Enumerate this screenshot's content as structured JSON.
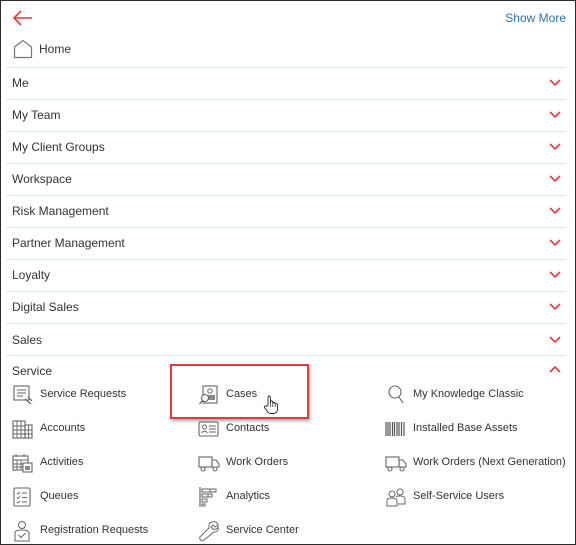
{
  "header": {
    "back_icon": "arrow-left-icon",
    "show_more_label": "Show More"
  },
  "home": {
    "label": "Home",
    "icon": "home-icon"
  },
  "sections": [
    {
      "label": "Me",
      "state": "collapsed"
    },
    {
      "label": "My Team",
      "state": "collapsed"
    },
    {
      "label": "My Client Groups",
      "state": "collapsed"
    },
    {
      "label": "Workspace",
      "state": "collapsed"
    },
    {
      "label": "Risk Management",
      "state": "collapsed"
    },
    {
      "label": "Partner Management",
      "state": "collapsed"
    },
    {
      "label": "Loyalty",
      "state": "collapsed"
    },
    {
      "label": "Digital Sales",
      "state": "collapsed"
    },
    {
      "label": "Sales",
      "state": "collapsed"
    }
  ],
  "service": {
    "label": "Service",
    "state": "expanded",
    "items": [
      {
        "label": "Service Requests",
        "icon": "service-request-icon"
      },
      {
        "label": "Cases",
        "icon": "cases-icon",
        "highlighted": true
      },
      {
        "label": "My Knowledge Classic",
        "icon": "search-icon"
      },
      {
        "label": "Accounts",
        "icon": "building-icon"
      },
      {
        "label": "Contacts",
        "icon": "contact-card-icon"
      },
      {
        "label": "Installed Base Assets",
        "icon": "barcode-icon"
      },
      {
        "label": "Activities",
        "icon": "calendar-icon"
      },
      {
        "label": "Work Orders",
        "icon": "truck-icon"
      },
      {
        "label": "Work Orders (Next Generation)",
        "icon": "truck-icon"
      },
      {
        "label": "Queues",
        "icon": "checklist-icon"
      },
      {
        "label": "Analytics",
        "icon": "analytics-icon"
      },
      {
        "label": "Self-Service Users",
        "icon": "users-icon"
      },
      {
        "label": "Registration Requests",
        "icon": "registration-icon"
      },
      {
        "label": "Service Center",
        "icon": "wrench-icon"
      }
    ]
  },
  "colors": {
    "accent": "#e0393e",
    "link": "#2e75a8",
    "divider": "#dde6ee",
    "highlight_border": "#e0393e"
  }
}
